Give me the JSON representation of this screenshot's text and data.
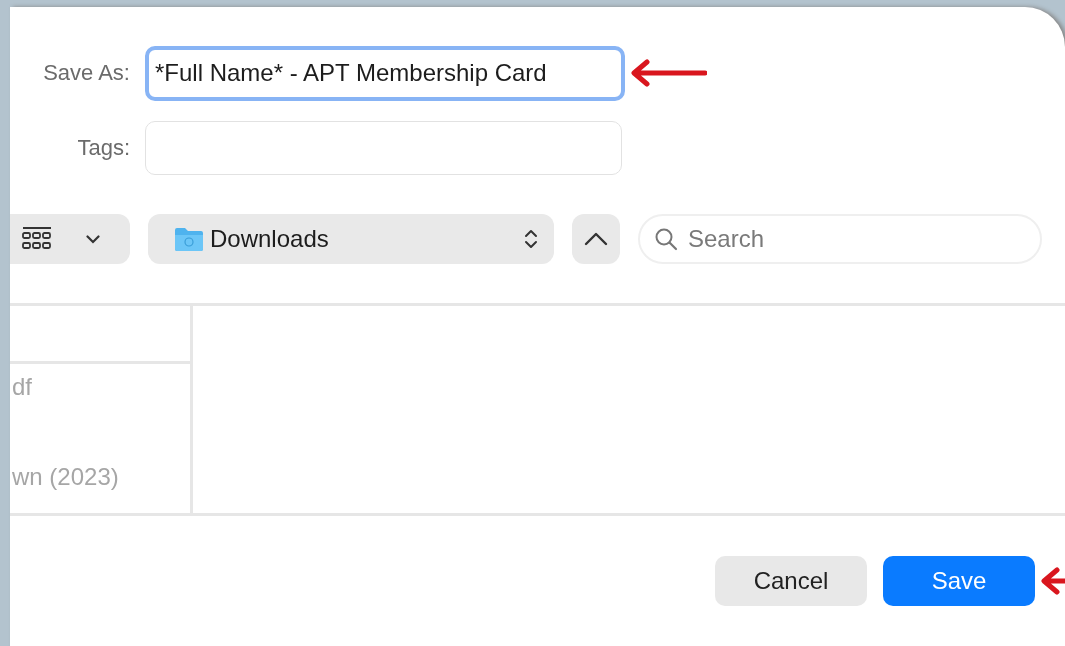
{
  "save_as": {
    "label": "Save As:",
    "value": "*Full Name* - APT Membership Card",
    "focused": true
  },
  "tags": {
    "label": "Tags:"
  },
  "toolbar": {
    "location": "Downloads",
    "search": {
      "placeholder": "Search"
    }
  },
  "files": [
    "df",
    "wn (2023)"
  ],
  "buttons": [
    {
      "label": "Cancel",
      "kind": "secondary"
    },
    {
      "label": "Save",
      "kind": "primary"
    }
  ]
}
